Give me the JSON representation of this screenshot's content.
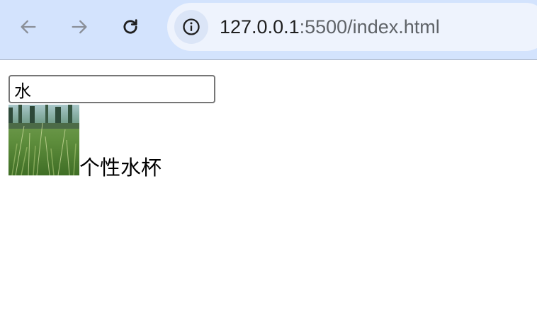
{
  "browser": {
    "url_host": "127.0.0.1",
    "url_rest": ":5500/index.html",
    "icons": {
      "back": "arrow-left-icon",
      "forward": "arrow-right-icon",
      "reload": "reload-icon",
      "site_info": "info-icon"
    }
  },
  "page": {
    "search_value": "水",
    "results": [
      {
        "image": "grass-field-photo",
        "label": "个性水杯"
      }
    ]
  }
}
